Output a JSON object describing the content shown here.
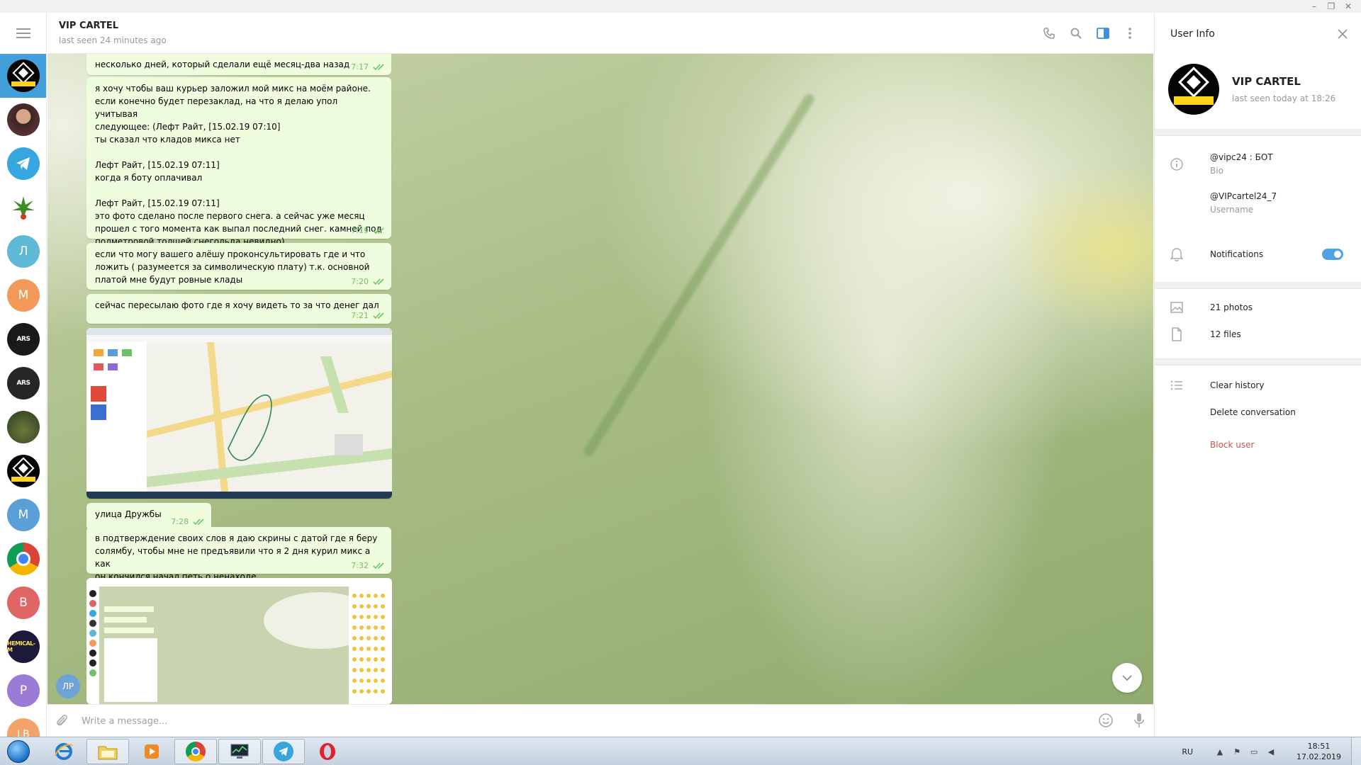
{
  "window": {
    "controls": [
      "–",
      "❐",
      "✕"
    ]
  },
  "sidebar": {
    "chats": [
      {
        "name": "vip-cartel",
        "initials": "",
        "color": "#050505",
        "active": true
      },
      {
        "name": "person-photo",
        "initials": "",
        "color": "#6b3b3a"
      },
      {
        "name": "telegram",
        "initials": "",
        "color": "#35a6de"
      },
      {
        "name": "leaf",
        "initials": "",
        "color": "#ffffff"
      },
      {
        "name": "contact-l",
        "initials": "Л",
        "color": "#5fb8d6"
      },
      {
        "name": "contact-m1",
        "initials": "М",
        "color": "#f39a5a"
      },
      {
        "name": "ars-1",
        "initials": "ARS",
        "color": "#1a1a1a"
      },
      {
        "name": "ars-2",
        "initials": "ARS",
        "color": "#262626"
      },
      {
        "name": "forest",
        "initials": "",
        "color": "#3a4a26"
      },
      {
        "name": "vip-cartel-2",
        "initials": "",
        "color": "#050505"
      },
      {
        "name": "contact-m2",
        "initials": "М",
        "color": "#5b9fd8"
      },
      {
        "name": "chrome",
        "initials": "",
        "color": "#ffffff"
      },
      {
        "name": "contact-v",
        "initials": "В",
        "color": "#e06666"
      },
      {
        "name": "chemical",
        "initials": "HEMICAL-M",
        "color": "#1b1a3a"
      },
      {
        "name": "contact-r",
        "initials": "Р",
        "color": "#9b7ad8"
      },
      {
        "name": "contact-lb",
        "initials": "LB",
        "color": "#f3a36a"
      }
    ]
  },
  "header": {
    "title": "VIP CARTEL",
    "status": "last seen 24 minutes ago"
  },
  "messages": [
    {
      "text": "несколько дней, который сделали ещё месяц-два назад",
      "time": "7:17"
    },
    {
      "text": "я хочу чтобы ваш курьер заложил мой микс на моём районе.\nесли конечно будет перезаклад, на что я делаю упол  учитывая\nследующее: (Лефт Райт, [15.02.19 07:10]\nты сказал что кладов микса нет\n\nЛефт Райт, [15.02.19 07:11]\nкогда я боту оплачивал\n\nЛефт Райт, [15.02.19 07:11]\nэто фото сделано после первого снега. а сейчас уже месяц\nпрошел с того момента как выпал последний снег. камней под\nполметровой толщей снегольда невидно)",
      "time": "7:19"
    },
    {
      "text": "если что могу вашего алёшу проконсультировать где и что\nложить ( разумеется за символическую плату) т.к. основной\nплатой мне будут ровные клады",
      "time": "7:20"
    },
    {
      "text": "сейчас пересылаю фото где я хочу видеть то за что денег дал",
      "time": "7:21"
    },
    {
      "text": "улица Дружбы",
      "time": "7:28"
    },
    {
      "text": "в подтверждение своих слов я даю скрины с датой где я беру\nсолямбу, чтобы мне не предъявили что я 2 дня курил микс а как\nон кончился начал петь о ненаходе",
      "time": "7:32"
    }
  ],
  "sender_avatar": "ЛР",
  "composer": {
    "placeholder": "Write a message..."
  },
  "panel": {
    "title": "User Info",
    "name": "VIP CARTEL",
    "seen": "last seen today at 18:26",
    "bio_value": "@vipc24 : БОТ",
    "bio_label": "Bio",
    "username_value": "@VIPcartel24_7",
    "username_label": "Username",
    "notifications": "Notifications",
    "notifications_on": true,
    "photos": "21 photos",
    "files": "12 files",
    "clear_history": "Clear history",
    "delete_conversation": "Delete conversation",
    "block_user": "Block user",
    "avatar_text": "VIP CARTEL",
    "danger_color": "#d14e4e"
  },
  "taskbar": {
    "apps": [
      "internet-explorer",
      "file-explorer",
      "media-player",
      "chrome",
      "task-manager",
      "telegram",
      "opera"
    ],
    "lang": "RU",
    "time": "18:51",
    "date": "17.02.2019"
  }
}
